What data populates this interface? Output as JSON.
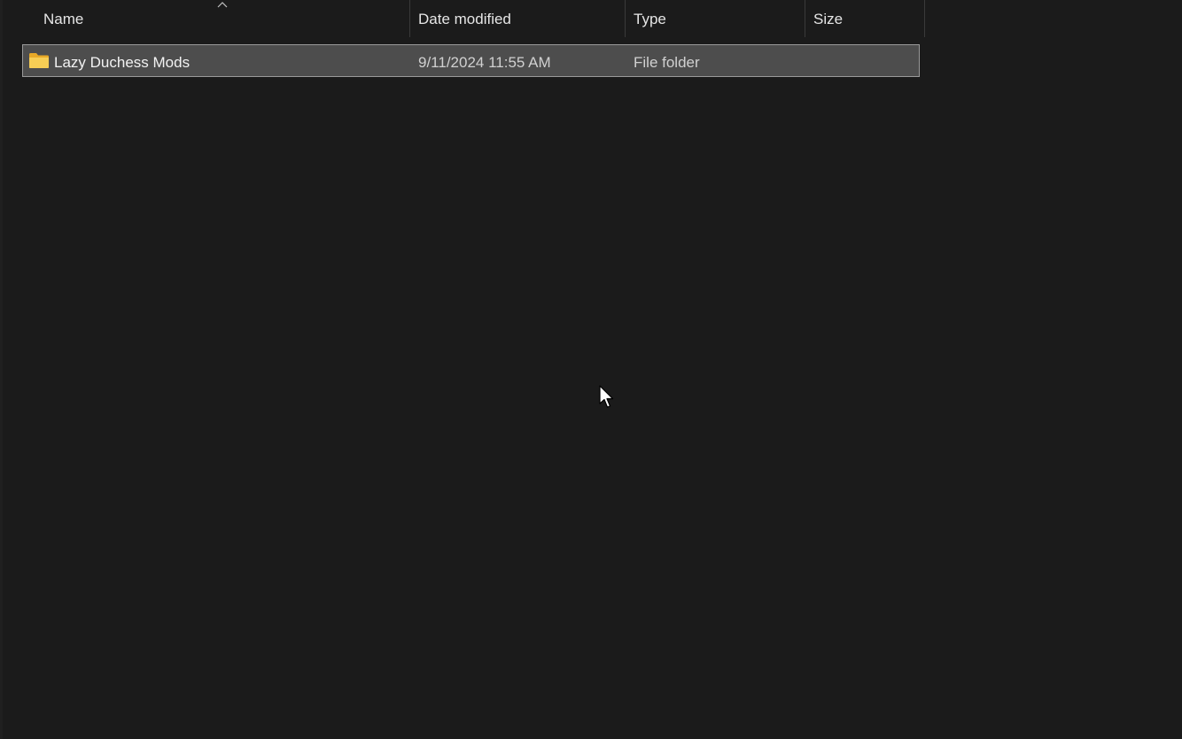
{
  "columns": {
    "name": "Name",
    "date_modified": "Date modified",
    "type": "Type",
    "size": "Size"
  },
  "sort": {
    "column": "Name",
    "direction": "ascending"
  },
  "rows": [
    {
      "name": "Lazy Duchess Mods",
      "date_modified": "9/11/2024 11:55 AM",
      "type": "File folder",
      "size": "",
      "icon": "folder-icon",
      "selected": true
    }
  ],
  "colors": {
    "background": "#1b1b1b",
    "selected_row": "#4d4d4d",
    "selected_border": "#9a9a9a",
    "folder": "#f4c542"
  }
}
